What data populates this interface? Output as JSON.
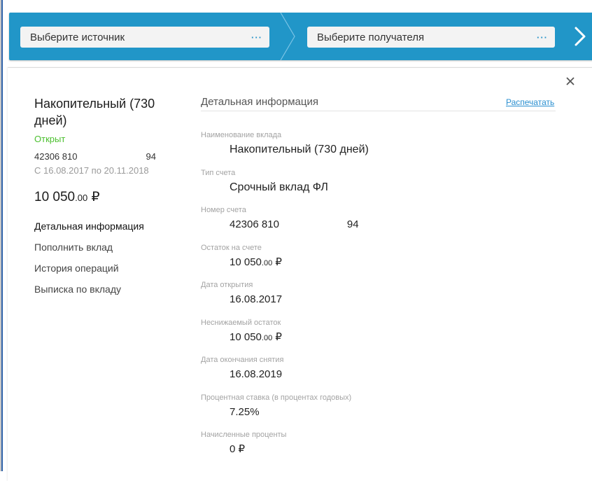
{
  "transfer": {
    "source_placeholder": "Выберите источник",
    "recipient_placeholder": "Выберите получателя",
    "more_label": "···",
    "bar_color": "#2196c8"
  },
  "deposit": {
    "name": "Накопительный (730 дней)",
    "status": "Открыт",
    "status_color": "#4cc02f",
    "account_start": "42306 810",
    "account_end": "94",
    "period": "С 16.08.2017 по 20.11.2018",
    "balance_main": "10 050",
    "balance_cents": ".00",
    "currency": "₽"
  },
  "menu": [
    {
      "label": "Детальная информация",
      "active": true
    },
    {
      "label": "Пополнить вклад",
      "active": false
    },
    {
      "label": "История операций",
      "active": false
    },
    {
      "label": "Выписка по вкладу",
      "active": false
    }
  ],
  "details": {
    "title": "Детальная информация",
    "print_label": "Распечатать",
    "fields": {
      "name": {
        "label": "Наименование вклада",
        "value": "Накопительный (730 дней)"
      },
      "type": {
        "label": "Тип счета",
        "value": "Срочный вклад ФЛ"
      },
      "account": {
        "label": "Номер счета",
        "value_start": "42306 810",
        "value_end": "94"
      },
      "balance": {
        "label": "Остаток на счете",
        "value_main": "10 050",
        "value_cents": ".00",
        "currency": "₽"
      },
      "open_date": {
        "label": "Дата открытия",
        "value": "16.08.2017"
      },
      "min_balance": {
        "label": "Неснижаемый остаток",
        "value_main": "10 050",
        "value_cents": ".00",
        "currency": "₽"
      },
      "withdraw_end": {
        "label": "Дата окончания снятия",
        "value": "16.08.2019"
      },
      "rate": {
        "label": "Процентная ставка (в процентах годовых)",
        "value": "7.25%"
      },
      "accrued": {
        "label": "Начисленные проценты",
        "value": "0 ₽"
      }
    }
  },
  "icons": {
    "close": "close-icon",
    "next": "chevron-right-icon"
  }
}
